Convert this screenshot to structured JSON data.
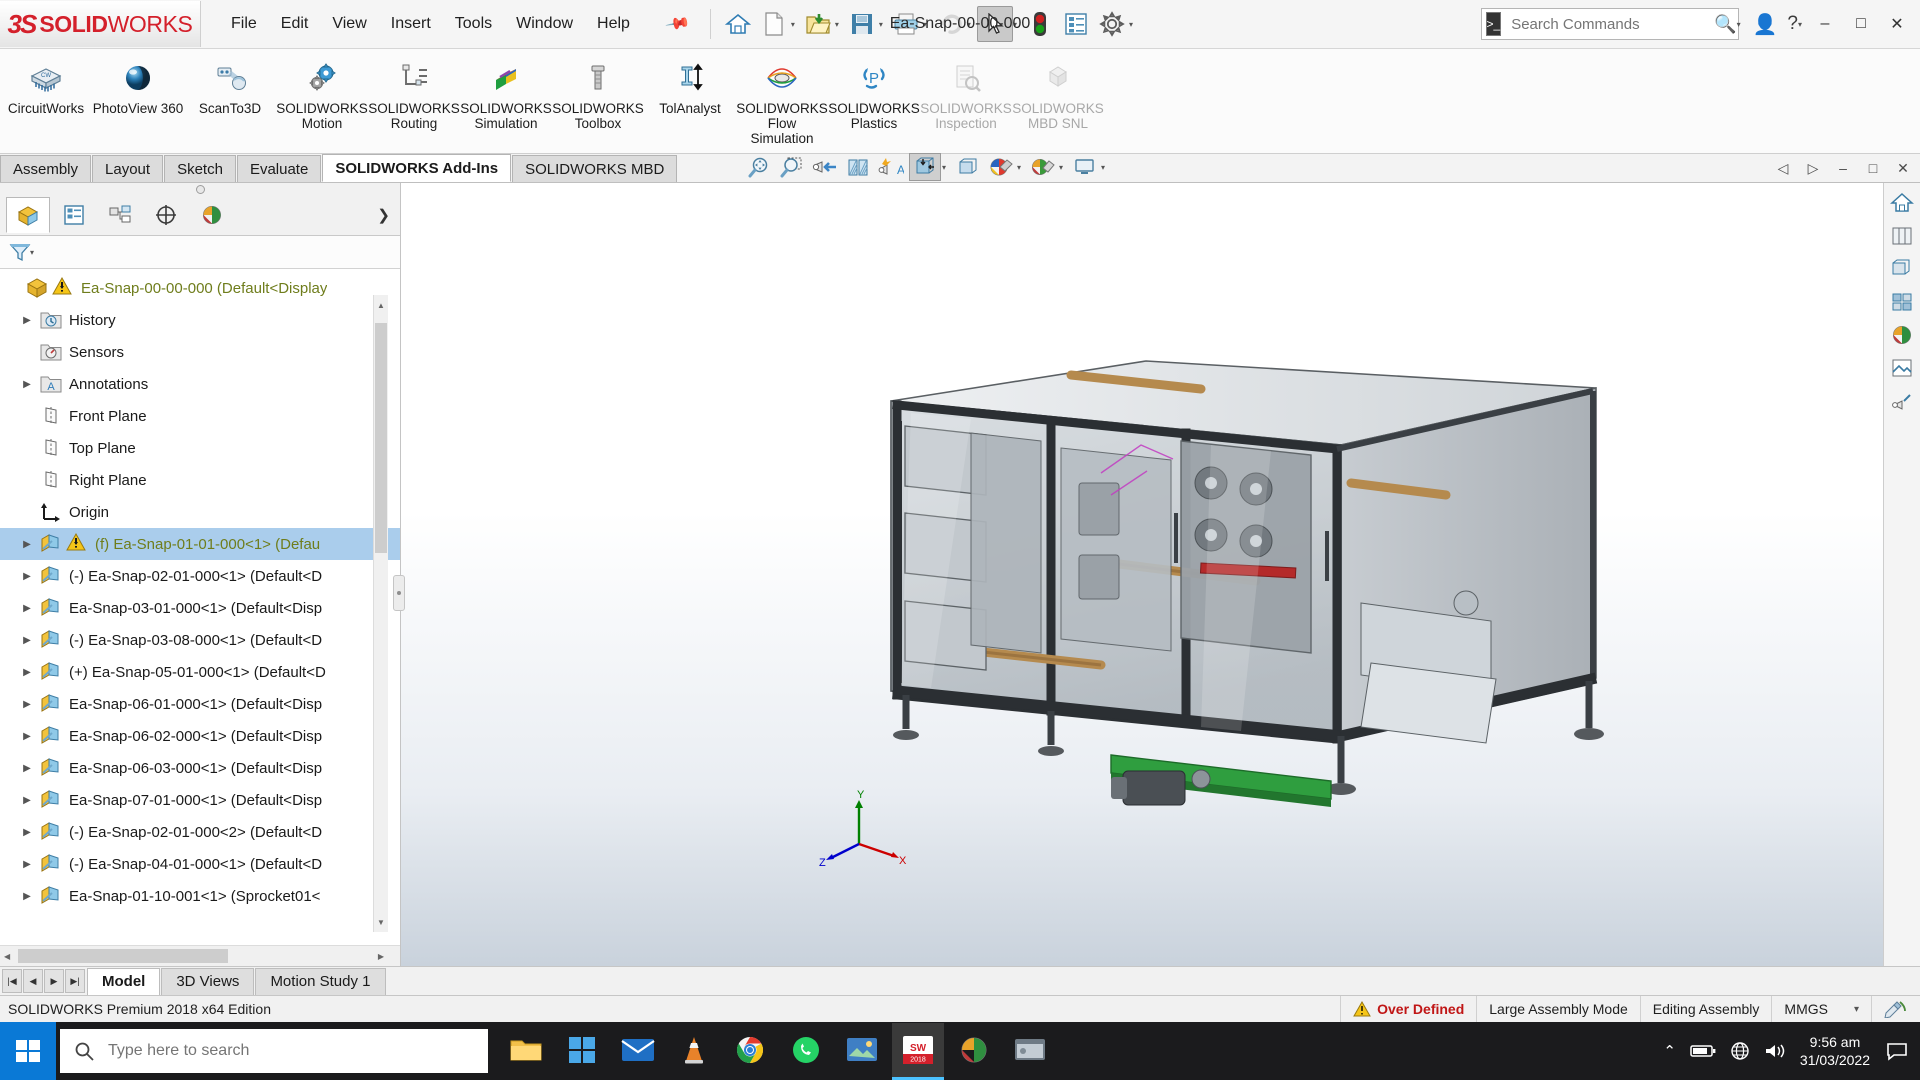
{
  "titlebar": {
    "brand": "SOLIDWORKS",
    "menus": [
      "File",
      "Edit",
      "View",
      "Insert",
      "Tools",
      "Window",
      "Help"
    ],
    "pin_icon": "pin-icon",
    "quick_access": [
      {
        "name": "home-icon",
        "label": "Home"
      },
      {
        "name": "new-document-icon",
        "label": "New"
      },
      {
        "name": "open-folder-icon",
        "label": "Open"
      },
      {
        "name": "save-icon",
        "label": "Save"
      },
      {
        "name": "print-icon",
        "label": "Print"
      },
      {
        "name": "undo-icon",
        "label": "Undo"
      },
      {
        "name": "select-cursor-icon",
        "label": "Select"
      },
      {
        "name": "traffic-light-icon",
        "label": "Rebuild"
      },
      {
        "name": "options-list-icon",
        "label": "File Properties"
      },
      {
        "name": "gear-icon",
        "label": "Options"
      }
    ],
    "document_title": "Ea-Snap-00-00-000",
    "search": {
      "placeholder": "Search Commands",
      "value": "",
      "prompt_icon": "command-prompt-icon",
      "search_icon": "magnifier-icon"
    },
    "account_icon": "user-account-icon",
    "help_icon": "help-question-icon",
    "window_controls": [
      "minimize",
      "maximize",
      "close"
    ]
  },
  "ribbon": {
    "items": [
      {
        "label": "CircuitWorks",
        "icon": "circuitworks-icon",
        "enabled": true
      },
      {
        "label": "PhotoView 360",
        "icon": "photoview-sphere-icon",
        "enabled": true
      },
      {
        "label": "ScanTo3D",
        "icon": "scanto3d-icon",
        "enabled": true
      },
      {
        "label": "SOLIDWORKS Motion",
        "icon": "motion-gears-icon",
        "enabled": true
      },
      {
        "label": "SOLIDWORKS Routing",
        "icon": "routing-icon",
        "enabled": true
      },
      {
        "label": "SOLIDWORKS Simulation",
        "icon": "simulation-cube-icon",
        "enabled": true
      },
      {
        "label": "SOLIDWORKS Toolbox",
        "icon": "toolbox-bolt-icon",
        "enabled": true
      },
      {
        "label": "TolAnalyst",
        "icon": "tolanalyst-icon",
        "enabled": true
      },
      {
        "label": "SOLIDWORKS Flow Simulation",
        "icon": "flow-simulation-icon",
        "enabled": true
      },
      {
        "label": "SOLIDWORKS Plastics",
        "icon": "plastics-icon",
        "enabled": true
      },
      {
        "label": "SOLIDWORKS Inspection",
        "icon": "inspection-icon",
        "enabled": false
      },
      {
        "label": "SOLIDWORKS MBD SNL",
        "icon": "mbd-snl-icon",
        "enabled": false
      }
    ]
  },
  "tabs": {
    "items": [
      "Assembly",
      "Layout",
      "Sketch",
      "Evaluate",
      "SOLIDWORKS Add-Ins",
      "SOLIDWORKS MBD"
    ],
    "active": "SOLIDWORKS Add-Ins"
  },
  "view_toolbar": [
    {
      "name": "zoom-to-fit-icon"
    },
    {
      "name": "zoom-to-area-icon"
    },
    {
      "name": "view-orientation-icon"
    },
    {
      "name": "section-view-icon"
    },
    {
      "name": "view-setting-icon"
    },
    {
      "name": "display-style-icon"
    },
    {
      "name": "hide-show-items-icon"
    },
    {
      "name": "edit-appearance-icon"
    },
    {
      "name": "apply-scene-icon"
    },
    {
      "name": "view-settings-display-icon"
    }
  ],
  "feature_manager": {
    "tabs": [
      {
        "name": "feature-tree-tab",
        "active": true
      },
      {
        "name": "property-manager-tab",
        "active": false
      },
      {
        "name": "configuration-manager-tab",
        "active": false
      },
      {
        "name": "dimxpert-manager-tab",
        "active": false
      },
      {
        "name": "display-manager-tab",
        "active": false
      }
    ],
    "filter_icon": "filter-funnel-icon",
    "tree": [
      {
        "label": "Ea-Snap-00-00-000  (Default<Display",
        "icon": "assembly-icon",
        "warning": true,
        "expandable": false,
        "indent": 0,
        "selected": false,
        "green": true
      },
      {
        "label": "History",
        "icon": "history-folder-icon",
        "warning": false,
        "expandable": true,
        "indent": 1,
        "selected": false,
        "green": false
      },
      {
        "label": "Sensors",
        "icon": "sensors-folder-icon",
        "warning": false,
        "expandable": false,
        "indent": 1,
        "selected": false,
        "green": false
      },
      {
        "label": "Annotations",
        "icon": "annotations-folder-icon",
        "warning": false,
        "expandable": true,
        "indent": 1,
        "selected": false,
        "green": false
      },
      {
        "label": "Front Plane",
        "icon": "plane-icon",
        "warning": false,
        "expandable": false,
        "indent": 1,
        "selected": false,
        "green": false
      },
      {
        "label": "Top Plane",
        "icon": "plane-icon",
        "warning": false,
        "expandable": false,
        "indent": 1,
        "selected": false,
        "green": false
      },
      {
        "label": "Right Plane",
        "icon": "plane-icon",
        "warning": false,
        "expandable": false,
        "indent": 1,
        "selected": false,
        "green": false
      },
      {
        "label": "Origin",
        "icon": "origin-icon",
        "warning": false,
        "expandable": false,
        "indent": 1,
        "selected": false,
        "green": false
      },
      {
        "label": "(f) Ea-Snap-01-01-000<1>  (Defau",
        "icon": "component-icon",
        "warning": true,
        "expandable": true,
        "indent": 1,
        "selected": true,
        "green": true
      },
      {
        "label": "(-) Ea-Snap-02-01-000<1> (Default<D",
        "icon": "component-icon",
        "warning": false,
        "expandable": true,
        "indent": 1,
        "selected": false,
        "green": false
      },
      {
        "label": "Ea-Snap-03-01-000<1> (Default<Disp",
        "icon": "component-icon",
        "warning": false,
        "expandable": true,
        "indent": 1,
        "selected": false,
        "green": false
      },
      {
        "label": "(-) Ea-Snap-03-08-000<1> (Default<D",
        "icon": "component-icon",
        "warning": false,
        "expandable": true,
        "indent": 1,
        "selected": false,
        "green": false
      },
      {
        "label": "(+) Ea-Snap-05-01-000<1> (Default<D",
        "icon": "component-icon",
        "warning": false,
        "expandable": true,
        "indent": 1,
        "selected": false,
        "green": false
      },
      {
        "label": "Ea-Snap-06-01-000<1> (Default<Disp",
        "icon": "component-icon",
        "warning": false,
        "expandable": true,
        "indent": 1,
        "selected": false,
        "green": false
      },
      {
        "label": "Ea-Snap-06-02-000<1> (Default<Disp",
        "icon": "component-icon",
        "warning": false,
        "expandable": true,
        "indent": 1,
        "selected": false,
        "green": false
      },
      {
        "label": "Ea-Snap-06-03-000<1> (Default<Disp",
        "icon": "component-icon",
        "warning": false,
        "expandable": true,
        "indent": 1,
        "selected": false,
        "green": false
      },
      {
        "label": "Ea-Snap-07-01-000<1> (Default<Disp",
        "icon": "component-icon",
        "warning": false,
        "expandable": true,
        "indent": 1,
        "selected": false,
        "green": false
      },
      {
        "label": "(-) Ea-Snap-02-01-000<2> (Default<D",
        "icon": "component-icon",
        "warning": false,
        "expandable": true,
        "indent": 1,
        "selected": false,
        "green": false
      },
      {
        "label": "(-) Ea-Snap-04-01-000<1> (Default<D",
        "icon": "component-icon",
        "warning": false,
        "expandable": true,
        "indent": 1,
        "selected": false,
        "green": false
      },
      {
        "label": "Ea-Snap-01-10-001<1> (Sprocket01<",
        "icon": "component-icon",
        "warning": false,
        "expandable": true,
        "indent": 1,
        "selected": false,
        "green": false
      }
    ]
  },
  "graphics": {
    "triad": {
      "x_label": "X",
      "y_label": "Y",
      "z_label": "Z",
      "x_color": "#cc0000",
      "y_color": "#008000",
      "z_color": "#0000cc"
    },
    "right_toolbar": [
      {
        "name": "view-home-icon"
      },
      {
        "name": "display-pane-icon"
      },
      {
        "name": "hide-show-icon"
      },
      {
        "name": "appearances-icon"
      },
      {
        "name": "scenes-icon"
      },
      {
        "name": "decals-icon"
      },
      {
        "name": "lights-cameras-icon"
      }
    ]
  },
  "bottom_tabs": {
    "items": [
      "Model",
      "3D Views",
      "Motion Study 1"
    ],
    "active": "Model",
    "nav_buttons": [
      "first",
      "previous",
      "next",
      "last"
    ]
  },
  "status_bar": {
    "edition": "SOLIDWORKS Premium 2018 x64 Edition",
    "warning_icon": "warning-triangle-icon",
    "over_defined": "Over Defined",
    "large_assembly": "Large Assembly Mode",
    "editing": "Editing Assembly",
    "units": "MMGS",
    "units_caret": "▾",
    "sync_icon": "sync-pencil-icon"
  },
  "taskbar": {
    "start_icon": "windows-start-icon",
    "search_placeholder": "Type here to search",
    "search_value": "",
    "search_icon": "magnifier-icon",
    "apps": [
      {
        "name": "file-explorer-icon",
        "active": false
      },
      {
        "name": "microsoft-store-icon",
        "active": false
      },
      {
        "name": "mail-icon",
        "active": false
      },
      {
        "name": "vlc-cone-icon",
        "active": false
      },
      {
        "name": "google-chrome-icon",
        "active": false
      },
      {
        "name": "whatsapp-icon",
        "active": false
      },
      {
        "name": "photos-icon",
        "active": false
      },
      {
        "name": "solidworks-app-icon",
        "active": true,
        "badge": "2018"
      },
      {
        "name": "photoview-app-icon",
        "active": false
      },
      {
        "name": "app-window-icon",
        "active": false
      }
    ],
    "tray": {
      "chevron_icon": "chevron-up-icon",
      "battery_icon": "battery-icon",
      "network_icon": "network-globe-icon",
      "volume_icon": "volume-icon",
      "time": "9:56 am",
      "date": "31/03/2022",
      "notification_icon": "notification-icon"
    }
  },
  "colors": {
    "brand_red": "#d4202b",
    "accent_blue": "#0a79d6",
    "tree_green": "#6f7d1c",
    "selection_blue": "#aacdec",
    "warning_red": "#c01616"
  }
}
